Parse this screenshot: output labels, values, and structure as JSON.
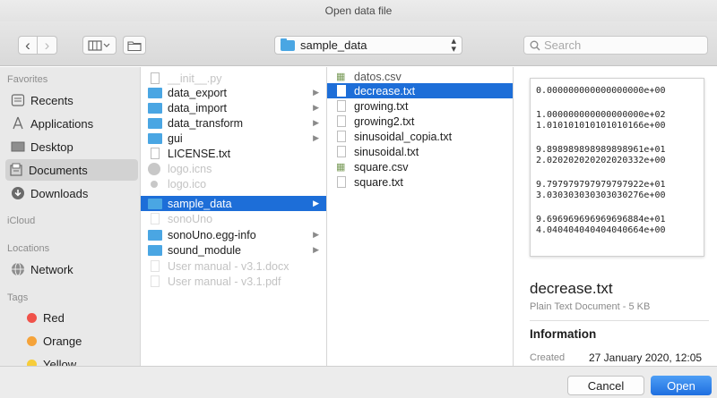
{
  "window": {
    "title": "Open data file"
  },
  "toolbar": {
    "back": "‹",
    "forward": "›",
    "view_icon": "column-view-icon",
    "new_folder_icon": "new-folder-icon",
    "path": "sample_data",
    "search_placeholder": "Search"
  },
  "sidebar": {
    "favorites_header": "Favorites",
    "favorites": [
      {
        "label": "Recents",
        "icon": "clock-icon"
      },
      {
        "label": "Applications",
        "icon": "applications-icon"
      },
      {
        "label": "Desktop",
        "icon": "desktop-icon"
      },
      {
        "label": "Documents",
        "icon": "documents-icon",
        "selected": true
      },
      {
        "label": "Downloads",
        "icon": "downloads-icon"
      }
    ],
    "icloud_header": "iCloud",
    "locations_header": "Locations",
    "locations": [
      {
        "label": "Network",
        "icon": "globe-icon"
      }
    ],
    "tags_header": "Tags",
    "tags": [
      {
        "label": "Red",
        "color": "#f0524a"
      },
      {
        "label": "Orange",
        "color": "#f5a33a"
      },
      {
        "label": "Yellow",
        "color": "#f7cd3a"
      }
    ]
  },
  "column1": [
    {
      "label": "__init__.py",
      "kind": "doc",
      "dim": true
    },
    {
      "label": "data_export",
      "kind": "folder",
      "arrow": true
    },
    {
      "label": "data_import",
      "kind": "folder",
      "arrow": true
    },
    {
      "label": "data_transform",
      "kind": "folder",
      "arrow": true
    },
    {
      "label": "gui",
      "kind": "folder",
      "arrow": true
    },
    {
      "label": "LICENSE.txt",
      "kind": "doc"
    },
    {
      "label": "logo.icns",
      "kind": "blur",
      "dim": true
    },
    {
      "label": "logo.ico",
      "kind": "blur",
      "dim": true
    },
    {
      "label": "sample_data",
      "kind": "folder",
      "arrow": true,
      "selected": true
    },
    {
      "label": "sonoUno",
      "kind": "doc",
      "dim": true
    },
    {
      "label": "sonoUno.egg-info",
      "kind": "folder",
      "arrow": true
    },
    {
      "label": "sound_module",
      "kind": "folder",
      "arrow": true
    },
    {
      "label": "User manual - v3.1.docx",
      "kind": "doc",
      "dim": true
    },
    {
      "label": "User manual - v3.1.pdf",
      "kind": "doc",
      "dim": true
    }
  ],
  "column2": [
    {
      "label": "datos.csv",
      "kind": "csv",
      "dim": true
    },
    {
      "label": "decrease.txt",
      "kind": "doc",
      "selected": true
    },
    {
      "label": "growing.txt",
      "kind": "doc"
    },
    {
      "label": "growing2.txt",
      "kind": "doc"
    },
    {
      "label": "sinusoidal_copia.txt",
      "kind": "doc"
    },
    {
      "label": "sinusoidal.txt",
      "kind": "doc"
    },
    {
      "label": "square.csv",
      "kind": "csv"
    },
    {
      "label": "square.txt",
      "kind": "doc"
    }
  ],
  "preview": {
    "content_groups": [
      [
        "0.000000000000000000e+00"
      ],
      [
        "1.000000000000000000e+02",
        "1.010101010101010166e+00"
      ],
      [
        "9.898989898989898961e+01",
        "2.020202020202020332e+00"
      ],
      [
        "9.797979797979797922e+01",
        "3.030303030303030276e+00"
      ],
      [
        "9.696969696969696884e+01",
        "4.040404040404040664e+00"
      ]
    ],
    "filename": "decrease.txt",
    "kind": "Plain Text Document - 5 KB",
    "info_header": "Information",
    "created_label": "Created",
    "created_value": "27 January 2020, 12:05"
  },
  "footer": {
    "cancel": "Cancel",
    "open": "Open"
  }
}
